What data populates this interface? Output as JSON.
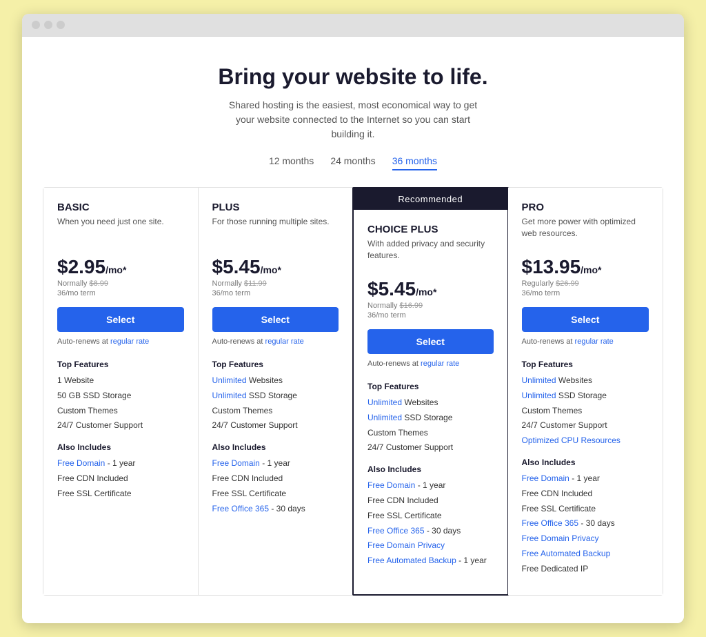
{
  "browser": {
    "dots": [
      "dot1",
      "dot2",
      "dot3"
    ]
  },
  "header": {
    "title": "Bring your website to life.",
    "subtitle": "Shared hosting is the easiest, most economical way to get your website connected to the Internet so you can start building it."
  },
  "terms": {
    "options": [
      "12 months",
      "24 months",
      "36 months"
    ],
    "active": "36 months"
  },
  "plans": [
    {
      "id": "basic",
      "recommended": false,
      "recommended_label": "",
      "name": "BASIC",
      "desc": "When you need just one site.",
      "price": "$2.95",
      "price_suffix": "/mo*",
      "normally_label": "Normally",
      "normally_price": "$8.99",
      "term": "36/mo term",
      "select_label": "Select",
      "auto_renew": "Auto-renews at",
      "auto_renew_link": "regular rate",
      "top_features_title": "Top Features",
      "top_features": [
        {
          "text": "1 Website",
          "link": false
        },
        {
          "text": "50 GB SSD Storage",
          "link": false
        },
        {
          "text": "Custom Themes",
          "link": false
        },
        {
          "text": "24/7 Customer Support",
          "link": false
        }
      ],
      "also_includes_title": "Also Includes",
      "also_includes": [
        {
          "text": "Free Domain",
          "link": true,
          "suffix": " - 1 year"
        },
        {
          "text": "Free CDN Included",
          "link": false
        },
        {
          "text": "Free SSL Certificate",
          "link": false
        }
      ]
    },
    {
      "id": "plus",
      "recommended": false,
      "recommended_label": "",
      "name": "PLUS",
      "desc": "For those running multiple sites.",
      "price": "$5.45",
      "price_suffix": "/mo*",
      "normally_label": "Normally",
      "normally_price": "$11.99",
      "term": "36/mo term",
      "select_label": "Select",
      "auto_renew": "Auto-renews at",
      "auto_renew_link": "regular rate",
      "top_features_title": "Top Features",
      "top_features": [
        {
          "text": "Unlimited",
          "link": true,
          "suffix": " Websites"
        },
        {
          "text": "Unlimited",
          "link": true,
          "suffix": " SSD Storage"
        },
        {
          "text": "Custom Themes",
          "link": false
        },
        {
          "text": "24/7 Customer Support",
          "link": false
        }
      ],
      "also_includes_title": "Also Includes",
      "also_includes": [
        {
          "text": "Free Domain",
          "link": true,
          "suffix": " - 1 year"
        },
        {
          "text": "Free CDN Included",
          "link": false
        },
        {
          "text": "Free SSL Certificate",
          "link": false
        },
        {
          "text": "Free Office 365",
          "link": true,
          "suffix": " - 30 days"
        }
      ]
    },
    {
      "id": "choice-plus",
      "recommended": true,
      "recommended_label": "Recommended",
      "name": "CHOICE PLUS",
      "desc": "With added privacy and security features.",
      "price": "$5.45",
      "price_suffix": "/mo*",
      "normally_label": "Normally",
      "normally_price": "$16.99",
      "term": "36/mo term",
      "select_label": "Select",
      "auto_renew": "Auto-renews at",
      "auto_renew_link": "regular rate",
      "top_features_title": "Top Features",
      "top_features": [
        {
          "text": "Unlimited",
          "link": true,
          "suffix": " Websites"
        },
        {
          "text": "Unlimited",
          "link": true,
          "suffix": " SSD Storage"
        },
        {
          "text": "Custom Themes",
          "link": false
        },
        {
          "text": "24/7 Customer Support",
          "link": false
        }
      ],
      "also_includes_title": "Also Includes",
      "also_includes": [
        {
          "text": "Free Domain",
          "link": true,
          "suffix": " - 1 year"
        },
        {
          "text": "Free CDN Included",
          "link": false
        },
        {
          "text": "Free SSL Certificate",
          "link": false
        },
        {
          "text": "Free Office 365",
          "link": true,
          "suffix": " - 30 days"
        },
        {
          "text": "Free Domain Privacy",
          "link": true,
          "suffix": ""
        },
        {
          "text": "Free Automated Backup",
          "link": true,
          "suffix": " - 1 year"
        }
      ]
    },
    {
      "id": "pro",
      "recommended": false,
      "recommended_label": "",
      "name": "PRO",
      "desc": "Get more power with optimized web resources.",
      "price": "$13.95",
      "price_suffix": "/mo*",
      "normally_label": "Regularly",
      "normally_price": "$26.99",
      "term": "36/mo term",
      "select_label": "Select",
      "auto_renew": "Auto-renews at",
      "auto_renew_link": "regular rate",
      "top_features_title": "Top Features",
      "top_features": [
        {
          "text": "Unlimited",
          "link": true,
          "suffix": " Websites"
        },
        {
          "text": "Unlimited",
          "link": true,
          "suffix": " SSD Storage"
        },
        {
          "text": "Custom Themes",
          "link": false
        },
        {
          "text": "24/7 Customer Support",
          "link": false
        },
        {
          "text": "Optimized CPU Resources",
          "link": true,
          "suffix": ""
        }
      ],
      "also_includes_title": "Also Includes",
      "also_includes": [
        {
          "text": "Free Domain",
          "link": true,
          "suffix": " - 1 year"
        },
        {
          "text": "Free CDN Included",
          "link": false
        },
        {
          "text": "Free SSL Certificate",
          "link": false
        },
        {
          "text": "Free Office 365",
          "link": true,
          "suffix": " - 30 days"
        },
        {
          "text": "Free Domain Privacy",
          "link": true,
          "suffix": ""
        },
        {
          "text": "Free Automated Backup",
          "link": true,
          "suffix": ""
        },
        {
          "text": "Free Dedicated IP",
          "link": false
        }
      ]
    }
  ]
}
